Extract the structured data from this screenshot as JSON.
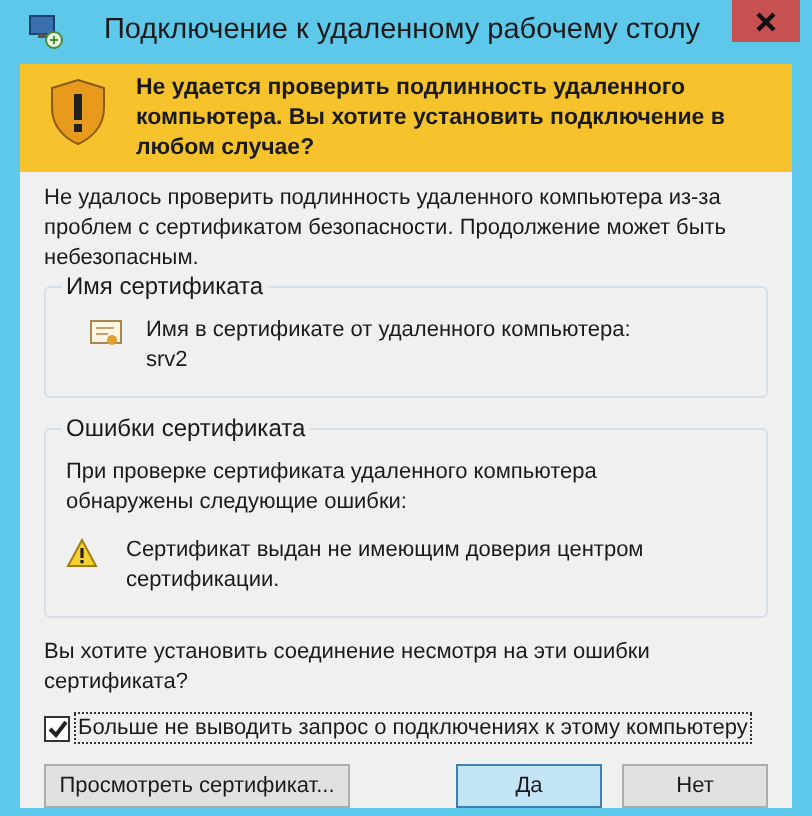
{
  "window": {
    "title": "Подключение к удаленному рабочему столу"
  },
  "banner": {
    "text": "Не удается проверить подлинность удаленного компьютера. Вы хотите установить подключение в любом случае?"
  },
  "intro": "Не удалось проверить подлинность удаленного компьютера из-за проблем с сертификатом безопасности. Продолжение может быть небезопасным.",
  "certificate_name": {
    "title": "Имя сертификата",
    "label": "Имя в сертификате от удаленного компьютера:",
    "value": "srv2"
  },
  "certificate_errors": {
    "title": "Ошибки сертификата",
    "text": "При проверке сертификата удаленного компьютера обнаружены следующие ошибки:",
    "errors": [
      "Сертификат выдан не имеющим доверия центром сертификации."
    ]
  },
  "question": "Вы хотите установить соединение несмотря на эти ошибки сертификата?",
  "checkbox": {
    "label": "Больше не выводить запрос о подключениях к этому компьютеру",
    "checked": true
  },
  "buttons": [
    {
      "label": "Просмотреть сертификат...",
      "selected": false
    },
    {
      "label": "Да",
      "selected": true
    },
    {
      "label": "Нет",
      "selected": false
    }
  ]
}
